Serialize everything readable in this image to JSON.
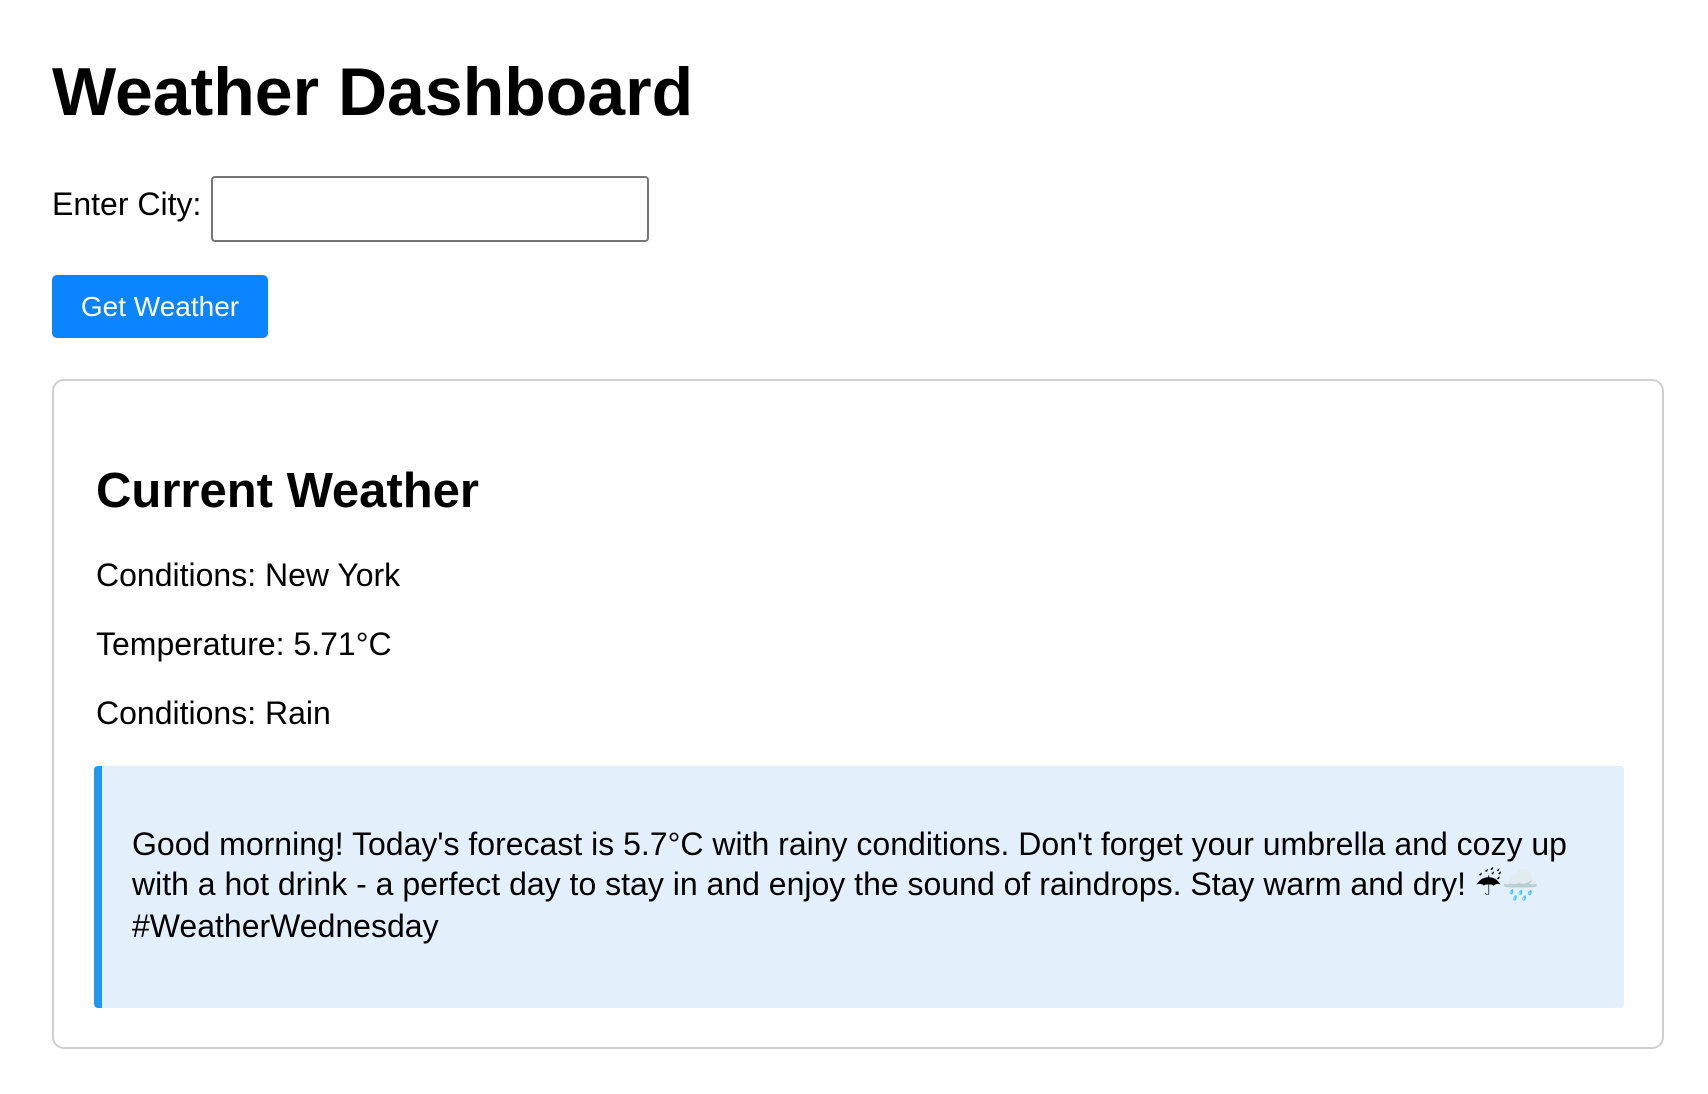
{
  "page": {
    "title": "Weather Dashboard"
  },
  "search": {
    "label": "Enter City:",
    "value": "",
    "placeholder": ""
  },
  "actions": {
    "get_weather_label": "Get Weather"
  },
  "current_weather": {
    "heading": "Current Weather",
    "location_line": "Conditions: New York",
    "temperature_line": "Temperature: 5.71°C",
    "conditions_line": "Conditions: Rain",
    "message": "Good morning! Today's forecast is 5.7°C with rainy conditions. Don't forget your umbrella and cozy up with a hot drink - a perfect day to stay in and enjoy the sound of raindrops. Stay warm and dry!",
    "message_emojis": "☔🌧️",
    "message_hashtag": "#WeatherWednesday"
  },
  "colors": {
    "button_bg": "#0a84ff",
    "message_bg": "#e3f0fc",
    "message_accent": "#2196f3",
    "card_border": "#cfcfcf"
  },
  "icons": {
    "umbrella_rain": "umbrella-rain-icon",
    "cloud_rain": "cloud-rain-icon"
  }
}
